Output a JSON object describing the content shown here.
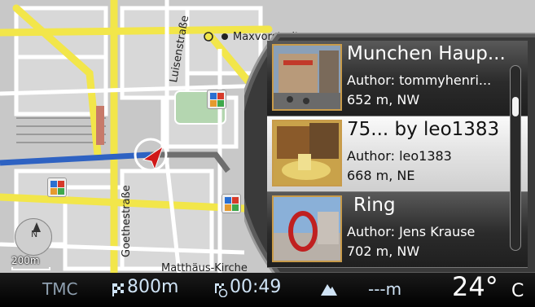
{
  "map": {
    "street_luisenstrasse": "Luisenstraße",
    "street_goethestrasse": "Goethestraße",
    "place_maxvorstadt": "Maxvorstadt",
    "place_matthaus_kirche": "Matthäus-Kirche",
    "scale_label": "200m",
    "compass_label": "N",
    "colors": {
      "route": "#2e62c2",
      "major_road": "#f2e64a",
      "land": "#c9c9c9",
      "park": "#b4d6b0"
    }
  },
  "poi_panel": {
    "entries": [
      {
        "title": "Munchen Haup...",
        "author": "Author: tommyhenri...",
        "distance": "652 m, NW"
      },
      {
        "title": "75... by leo1383",
        "author": "Author: leo1383",
        "distance": "668 m, NE"
      },
      {
        "title": "Ring",
        "author": "Author: Jens Krause",
        "distance": "702 m, NW"
      }
    ]
  },
  "statusbar": {
    "tmc": "TMC",
    "distance": "800m",
    "time": "00:49",
    "altitude": "---m",
    "temperature": "24°",
    "temperature_unit": "C"
  }
}
